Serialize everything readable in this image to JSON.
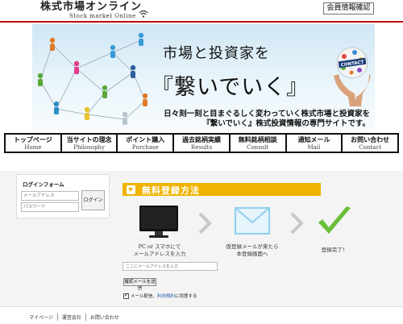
{
  "header": {
    "logo_title": "株式市場オンライン",
    "logo_subtitle": "Stock market Online",
    "member_button": "会員情報確認"
  },
  "banner": {
    "line1": "市場と投資家を",
    "line2": "『繋いでいく』",
    "tagline1": "日々刻一刻と目まぐるしく変わっていく株式市場と投資家を",
    "tagline2": "『繋いでいく』株式投資情報の専門サイトです。",
    "globe_label": "CONTACT"
  },
  "nav": {
    "items": [
      {
        "jp": "トップページ",
        "en": "Home"
      },
      {
        "jp": "当サイトの理念",
        "en": "Philosophy"
      },
      {
        "jp": "ポイント購入",
        "en": "Purchase"
      },
      {
        "jp": "過去銘柄実績",
        "en": "Results"
      },
      {
        "jp": "無料銘柄相談",
        "en": "Consult"
      },
      {
        "jp": "通知メール",
        "en": "Mail"
      },
      {
        "jp": "お問い合わせ",
        "en": "Contact"
      }
    ]
  },
  "login": {
    "title": "ログインフォーム",
    "email_placeholder": "メールアドレス",
    "password_placeholder": "パスワード",
    "button": "ログイン"
  },
  "registration": {
    "title": "無料登録方法",
    "step1": [
      "PC or スマホにて",
      "メールアドレスを入力"
    ],
    "step2": [
      "仮登録メールが来たら",
      "本登録画面へ"
    ],
    "step3": [
      "登録完了！"
    ],
    "email_placeholder": "ここにメールアドレスを入力",
    "confirm_button": "確認メールを送信",
    "agree_prefix": "メール配信、",
    "agree_link": "利用規約",
    "agree_suffix": "に同意する"
  },
  "footer": {
    "links": [
      "マイページ",
      "運営会社",
      "お問い合わせ"
    ]
  },
  "colors": {
    "accent_red": "#c00000",
    "reg_header": "#f0b400",
    "check_green": "#6abf3a",
    "envelope_blue": "#8fd0ef"
  }
}
